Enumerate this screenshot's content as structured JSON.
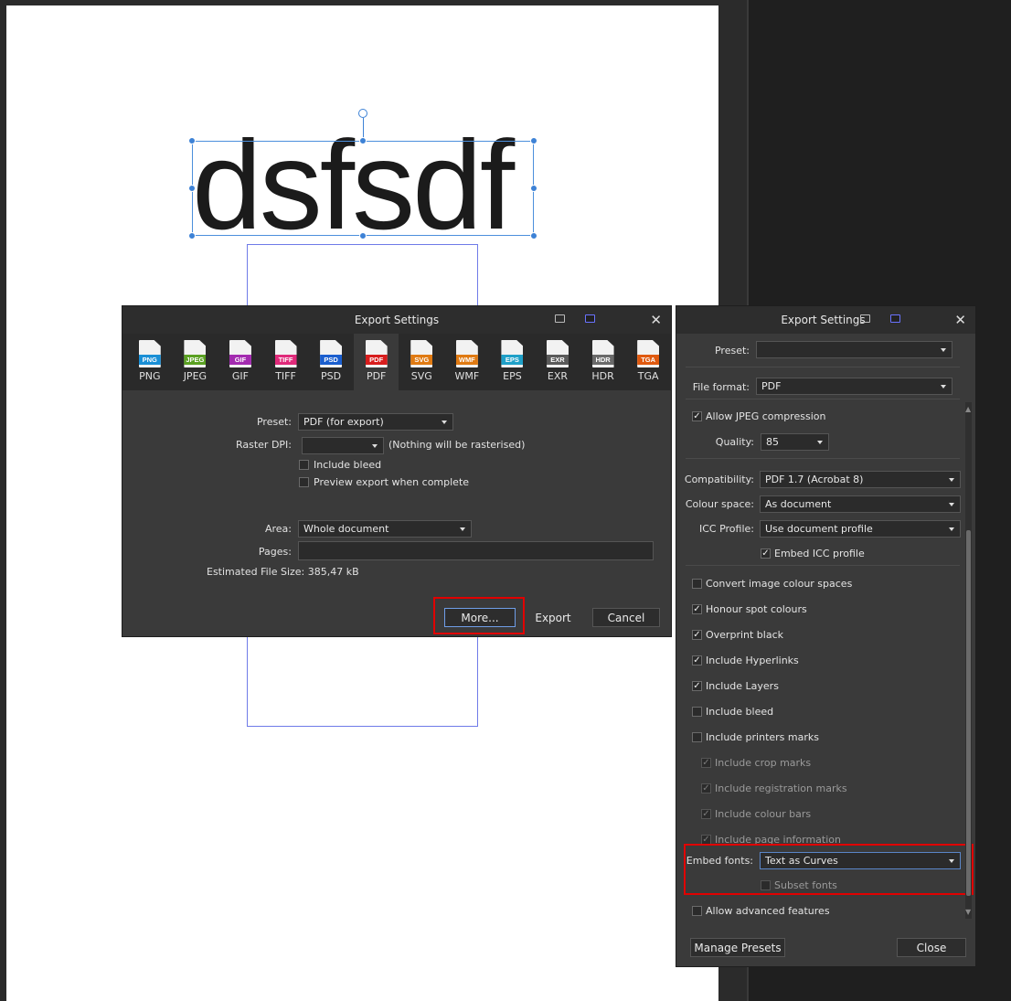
{
  "canvas": {
    "text": "dsfsdf"
  },
  "export_dialog": {
    "title": "Export Settings",
    "close": "✕",
    "formats": [
      {
        "badge": "PNG",
        "label": "PNG",
        "color": "#1a8fd6"
      },
      {
        "badge": "JPEG",
        "label": "JPEG",
        "color": "#5aa022"
      },
      {
        "badge": "GIF",
        "label": "GIF",
        "color": "#a32bb0"
      },
      {
        "badge": "TIFF",
        "label": "TIFF",
        "color": "#e02a7a"
      },
      {
        "badge": "PSD",
        "label": "PSD",
        "color": "#1b5fcf"
      },
      {
        "badge": "PDF",
        "label": "PDF",
        "color": "#d81d1d"
      },
      {
        "badge": "SVG",
        "label": "SVG",
        "color": "#e07a12"
      },
      {
        "badge": "WMF",
        "label": "WMF",
        "color": "#e07a12"
      },
      {
        "badge": "EPS",
        "label": "EPS",
        "color": "#1fa0c8"
      },
      {
        "badge": "EXR",
        "label": "EXR",
        "color": "#5a5a5a"
      },
      {
        "badge": "HDR",
        "label": "HDR",
        "color": "#6a6a6a"
      },
      {
        "badge": "TGA",
        "label": "TGA",
        "color": "#e05a10"
      }
    ],
    "active_format": "PDF",
    "preset_label": "Preset:",
    "preset_value": "PDF (for export)",
    "raster_dpi_label": "Raster DPI:",
    "raster_dpi_value": "",
    "raster_note": "(Nothing will be rasterised)",
    "include_bleed": "Include bleed",
    "preview_export": "Preview export when complete",
    "area_label": "Area:",
    "area_value": "Whole document",
    "pages_label": "Pages:",
    "pages_value": "",
    "estimated_size": "Estimated File Size: 385,47 kB",
    "more_button": "More...",
    "export_button": "Export",
    "cancel_button": "Cancel"
  },
  "more_dialog": {
    "title": "Export Settings",
    "close": "✕",
    "preset_label": "Preset:",
    "preset_value": "",
    "file_format_label": "File format:",
    "file_format_value": "PDF",
    "allow_jpeg": "Allow JPEG compression",
    "quality_label": "Quality:",
    "quality_value": "85",
    "compatibility_label": "Compatibility:",
    "compatibility_value": "PDF 1.7 (Acrobat 8)",
    "colour_space_label": "Colour space:",
    "colour_space_value": "As document",
    "icc_profile_label": "ICC Profile:",
    "icc_profile_value": "Use document profile",
    "embed_icc": "Embed ICC profile",
    "options": [
      {
        "label": "Convert image colour spaces",
        "checked": false,
        "disabled": false
      },
      {
        "label": "Honour spot colours",
        "checked": true,
        "disabled": false
      },
      {
        "label": "Overprint black",
        "checked": true,
        "disabled": false
      },
      {
        "label": "Include Hyperlinks",
        "checked": true,
        "disabled": false
      },
      {
        "label": "Include Layers",
        "checked": true,
        "disabled": false
      },
      {
        "label": "Include bleed",
        "checked": false,
        "disabled": false
      },
      {
        "label": "Include printers marks",
        "checked": false,
        "disabled": false
      },
      {
        "label": "Include crop marks",
        "checked": true,
        "disabled": true
      },
      {
        "label": "Include registration marks",
        "checked": true,
        "disabled": true
      },
      {
        "label": "Include colour bars",
        "checked": true,
        "disabled": true
      },
      {
        "label": "Include page information",
        "checked": true,
        "disabled": true
      }
    ],
    "embed_fonts_label": "Embed fonts:",
    "embed_fonts_value": "Text as Curves",
    "subset_fonts": "Subset fonts",
    "allow_advanced": "Allow advanced features",
    "manage_presets_button": "Manage Presets",
    "close_button": "Close"
  },
  "colors": {
    "highlight": "#e10000",
    "selection": "#3d82d6"
  }
}
